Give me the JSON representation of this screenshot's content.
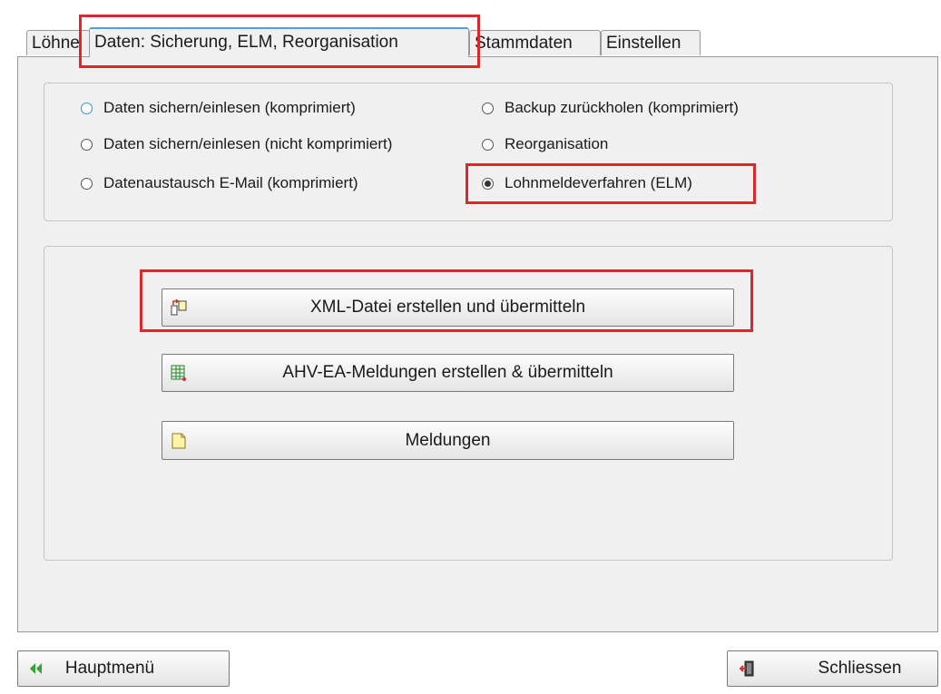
{
  "tabs": [
    {
      "label": "Löhne"
    },
    {
      "label": "Daten: Sicherung, ELM, Reorganisation"
    },
    {
      "label": "Stammdaten"
    },
    {
      "label": "Einstellen"
    }
  ],
  "options": {
    "daten_komprimiert": "Daten sichern/einlesen (komprimiert)",
    "daten_nicht_komprimiert": "Daten sichern/einlesen (nicht komprimiert)",
    "datenaustausch_email": "Datenaustausch E-Mail (komprimiert)",
    "backup": "Backup zurückholen (komprimiert)",
    "reorganisation": "Reorganisation",
    "elm": "Lohnmeldeverfahren (ELM)"
  },
  "actions": {
    "xml": "XML-Datei erstellen und übermitteln",
    "ahv": "AHV-EA-Meldungen erstellen & übermitteln",
    "meldungen": "Meldungen"
  },
  "footer": {
    "hauptmenu": "Hauptmenü",
    "schliessen": "Schliessen"
  },
  "colors": {
    "highlight": "#e0262b",
    "active_tab": "#5b9bd5"
  }
}
